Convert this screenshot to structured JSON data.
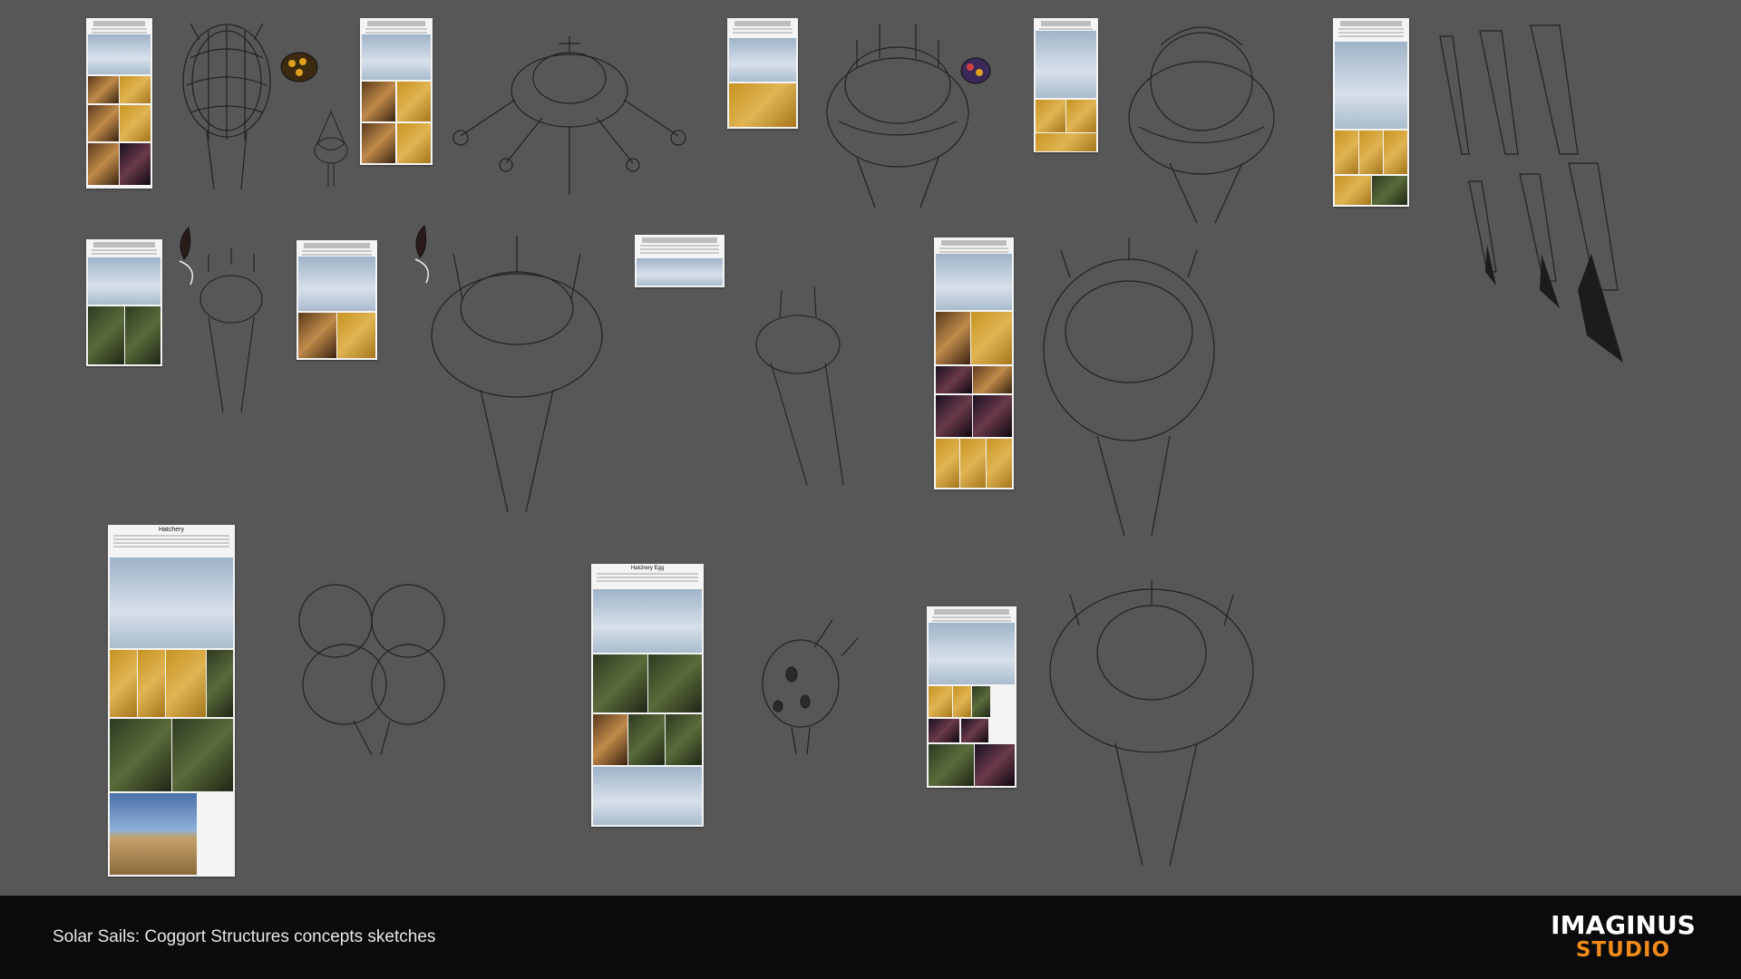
{
  "footer": {
    "caption": "Solar Sails: Coggort Structures concepts sketches",
    "logo_line1": "IMAGINUS",
    "logo_line2": "STUDIO"
  },
  "colors": {
    "background": "#575757",
    "footer": "#0b0b0b",
    "brand_white": "#ffffff",
    "brand_orange": "#f08a1c"
  },
  "reference_cards": {
    "hatchery_title": "Hatchery",
    "hatchery_egg_title": "Hatchery Egg"
  }
}
